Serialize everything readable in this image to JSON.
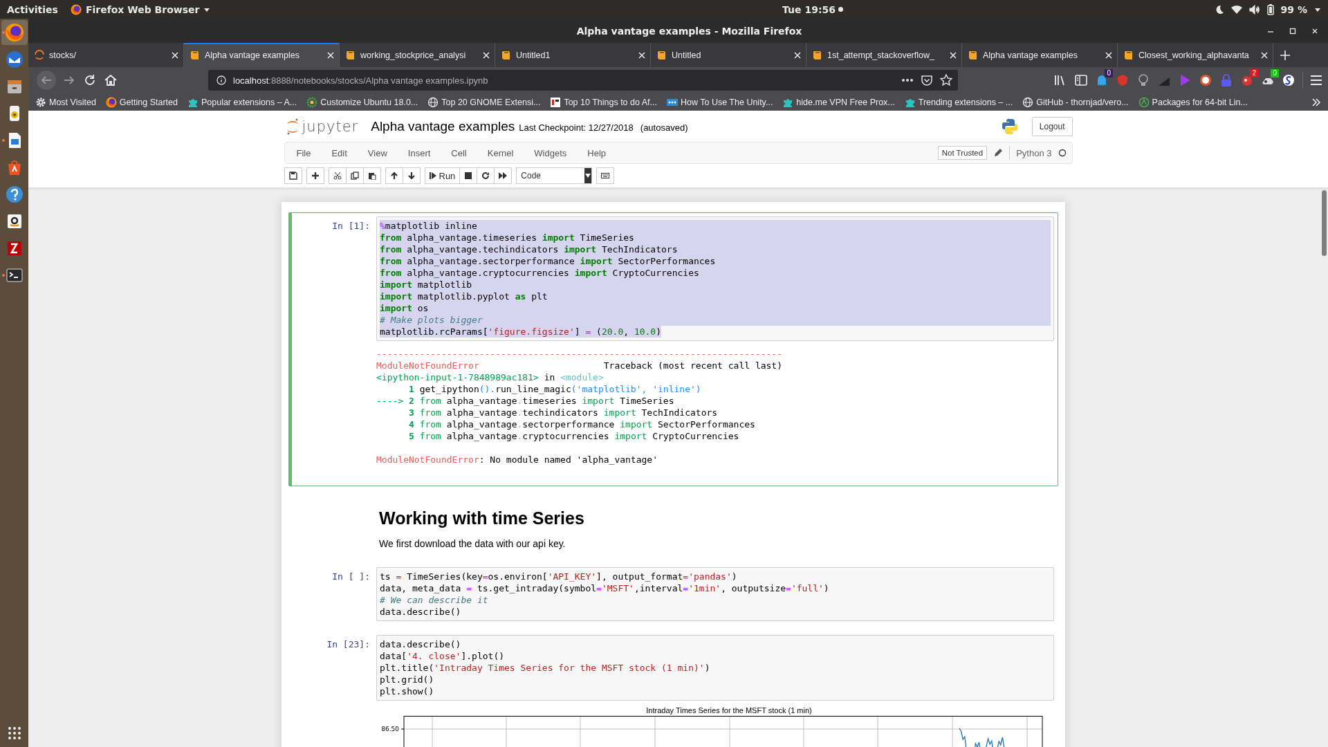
{
  "top_bar": {
    "activities": "Activities",
    "app_menu": "Firefox Web Browser",
    "clock": "Tue 19:56",
    "battery": "99 %"
  },
  "dock": [
    {
      "kind": "firefox",
      "running": true,
      "selected": true
    },
    {
      "kind": "mail",
      "running": false,
      "selected": false
    },
    {
      "kind": "files",
      "running": false,
      "selected": false
    },
    {
      "kind": "music",
      "running": false,
      "selected": false
    },
    {
      "kind": "writer",
      "running": true,
      "selected": false
    },
    {
      "kind": "software",
      "running": false,
      "selected": false
    },
    {
      "kind": "help",
      "running": false,
      "selected": false
    },
    {
      "kind": "amazon",
      "running": false,
      "selected": false
    },
    {
      "kind": "filezilla",
      "running": false,
      "selected": false
    },
    {
      "kind": "terminal",
      "running": true,
      "selected": false
    }
  ],
  "window": {
    "title": "Alpha vantage examples - Mozilla Firefox"
  },
  "tabs": [
    {
      "label": "stocks/",
      "kind": "jupyter",
      "selected": false
    },
    {
      "label": "Alpha vantage examples",
      "kind": "notebook",
      "selected": true
    },
    {
      "label": "working_stockprice_analysi",
      "kind": "notebook",
      "selected": false
    },
    {
      "label": "Untitled1",
      "kind": "notebook",
      "selected": false
    },
    {
      "label": "Untitled",
      "kind": "notebook",
      "selected": false
    },
    {
      "label": "1st_attempt_stackoverflow_",
      "kind": "notebook",
      "selected": false
    },
    {
      "label": "Alpha vantage examples",
      "kind": "notebook",
      "selected": false
    },
    {
      "label": "Closest_working_alphavanta",
      "kind": "notebook",
      "selected": false
    }
  ],
  "address_bar": {
    "host": "localhost",
    "path": ":8888/notebooks/stocks/Alpha vantage examples.ipynb"
  },
  "toolbar_badges": [
    {
      "text": "0",
      "color": "#3b1d5e"
    },
    {
      "text": "2",
      "color": "#e8141c"
    },
    {
      "text": "0",
      "color": "#16c60c"
    }
  ],
  "bookmarks": [
    {
      "label": "Most Visited",
      "kind": "gear"
    },
    {
      "label": "Getting Started",
      "kind": "firefox"
    },
    {
      "label": "Popular extensions – A...",
      "kind": "puzzle"
    },
    {
      "label": "Customize Ubuntu 18.0...",
      "kind": "cog"
    },
    {
      "label": "Top 20 GNOME Extensi...",
      "kind": "globe"
    },
    {
      "label": "Top 10 Things to do Af...",
      "kind": "square"
    },
    {
      "label": "How To Use The Unity...",
      "kind": "dots"
    },
    {
      "label": "hide.me VPN Free Prox...",
      "kind": "puzzle"
    },
    {
      "label": "Trending extensions – ...",
      "kind": "puzzle"
    },
    {
      "label": "GitHub - thornjad/vero...",
      "kind": "globe"
    },
    {
      "label": "Packages for 64-bit Lin...",
      "kind": "circle"
    }
  ],
  "notebook": {
    "logo": "jupyter",
    "title": "Alpha vantage examples",
    "checkpoint": "Last Checkpoint: 12/27/2018",
    "autosave": "(autosaved)",
    "logout": "Logout",
    "menu": [
      "File",
      "Edit",
      "View",
      "Insert",
      "Cell",
      "Kernel",
      "Widgets",
      "Help"
    ],
    "trust": "Not Trusted",
    "kernel": {
      "name": "Python 3",
      "busy": false
    },
    "run_label": "Run",
    "cell_type": "Code",
    "cells": [
      {
        "kind": "code",
        "prompt": "In [1]:",
        "selected": true,
        "lines": [
          {
            "selected": true,
            "tokens": [
              {
                "kind": "magic",
                "text": "%"
              },
              {
                "kind": "plain",
                "text": "matplotlib inline"
              }
            ]
          },
          {
            "selected": true,
            "tokens": [
              {
                "kind": "kw",
                "text": "from"
              },
              {
                "kind": "plain",
                "text": " alpha_vantage.timeseries "
              },
              {
                "kind": "kw",
                "text": "import"
              },
              {
                "kind": "plain",
                "text": " TimeSeries"
              }
            ]
          },
          {
            "selected": true,
            "tokens": [
              {
                "kind": "kw",
                "text": "from"
              },
              {
                "kind": "plain",
                "text": " alpha_vantage.techindicators "
              },
              {
                "kind": "kw",
                "text": "import"
              },
              {
                "kind": "plain",
                "text": " TechIndicators"
              }
            ]
          },
          {
            "selected": true,
            "tokens": [
              {
                "kind": "kw",
                "text": "from"
              },
              {
                "kind": "plain",
                "text": " alpha_vantage.sectorperformance "
              },
              {
                "kind": "kw",
                "text": "import"
              },
              {
                "kind": "plain",
                "text": " SectorPerformances"
              }
            ]
          },
          {
            "selected": true,
            "tokens": [
              {
                "kind": "kw",
                "text": "from"
              },
              {
                "kind": "plain",
                "text": " alpha_vantage.cryptocurrencies "
              },
              {
                "kind": "kw",
                "text": "import"
              },
              {
                "kind": "plain",
                "text": " CryptoCurrencies"
              }
            ]
          },
          {
            "selected": true,
            "tokens": [
              {
                "kind": "kw",
                "text": "import"
              },
              {
                "kind": "plain",
                "text": " matplotlib"
              }
            ]
          },
          {
            "selected": true,
            "tokens": [
              {
                "kind": "kw",
                "text": "import"
              },
              {
                "kind": "plain",
                "text": " matplotlib.pyplot "
              },
              {
                "kind": "kw",
                "text": "as"
              },
              {
                "kind": "plain",
                "text": " plt"
              }
            ]
          },
          {
            "selected": true,
            "tokens": [
              {
                "kind": "kw",
                "text": "import"
              },
              {
                "kind": "plain",
                "text": " os"
              }
            ]
          },
          {
            "selected": true,
            "tokens": [
              {
                "kind": "comment",
                "text": "# Make plots bigger"
              }
            ]
          },
          {
            "selected": true,
            "tokens": [
              {
                "kind": "plain",
                "text": "matplotlib.rcParams["
              },
              {
                "kind": "str",
                "text": "'figure.figsize'"
              },
              {
                "kind": "plain",
                "text": "] "
              },
              {
                "kind": "op",
                "text": "="
              },
              {
                "kind": "plain",
                "text": " ("
              },
              {
                "kind": "num",
                "text": "20.0"
              },
              {
                "kind": "plain",
                "text": ", "
              },
              {
                "kind": "num",
                "text": "10.0"
              },
              {
                "kind": "plain",
                "text": ")"
              }
            ]
          }
        ],
        "output": {
          "kind": "error",
          "traceback": [
            [
              {
                "kind": "err",
                "text": "---------------------------------------------------------------------------"
              }
            ],
            [
              {
                "kind": "err",
                "text": "ModuleNotFoundError"
              },
              {
                "kind": "plain",
                "text": "                       Traceback (most recent call last)"
              }
            ],
            [
              {
                "kind": "file",
                "text": "<ipython-input-1-7848989ac181>"
              },
              {
                "kind": "plain",
                "text": " in "
              },
              {
                "kind": "mod",
                "text": "<module>"
              }
            ],
            [
              {
                "kind": "lineno",
                "text": "      1 "
              },
              {
                "kind": "plain",
                "text": "get_ipython"
              },
              {
                "kind": "call",
                "text": "()."
              },
              {
                "kind": "plain",
                "text": "run_line_magic"
              },
              {
                "kind": "call",
                "text": "('matplotlib', 'inline')"
              }
            ],
            [
              {
                "kind": "arrow",
                "text": "----> "
              },
              {
                "kind": "lineno",
                "text": "2 "
              },
              {
                "kind": "tkw",
                "text": "from"
              },
              {
                "kind": "plain",
                "text": " alpha_vantage"
              },
              {
                "kind": "mod",
                "text": "."
              },
              {
                "kind": "plain",
                "text": "timeseries "
              },
              {
                "kind": "tkw",
                "text": "import"
              },
              {
                "kind": "plain",
                "text": " TimeSeries"
              }
            ],
            [
              {
                "kind": "lineno",
                "text": "      3 "
              },
              {
                "kind": "tkw",
                "text": "from"
              },
              {
                "kind": "plain",
                "text": " alpha_vantage"
              },
              {
                "kind": "mod",
                "text": "."
              },
              {
                "kind": "plain",
                "text": "techindicators "
              },
              {
                "kind": "tkw",
                "text": "import"
              },
              {
                "kind": "plain",
                "text": " TechIndicators"
              }
            ],
            [
              {
                "kind": "lineno",
                "text": "      4 "
              },
              {
                "kind": "tkw",
                "text": "from"
              },
              {
                "kind": "plain",
                "text": " alpha_vantage"
              },
              {
                "kind": "mod",
                "text": "."
              },
              {
                "kind": "plain",
                "text": "sectorperformance "
              },
              {
                "kind": "tkw",
                "text": "import"
              },
              {
                "kind": "plain",
                "text": " SectorPerformances"
              }
            ],
            [
              {
                "kind": "lineno",
                "text": "      5 "
              },
              {
                "kind": "tkw",
                "text": "from"
              },
              {
                "kind": "plain",
                "text": " alpha_vantage"
              },
              {
                "kind": "mod",
                "text": "."
              },
              {
                "kind": "plain",
                "text": "cryptocurrencies "
              },
              {
                "kind": "tkw",
                "text": "import"
              },
              {
                "kind": "plain",
                "text": " CryptoCurrencies"
              }
            ]
          ],
          "message": [
            {
              "kind": "err",
              "text": "ModuleNotFoundError"
            },
            {
              "kind": "plain",
              "text": ": No module named 'alpha_vantage'"
            }
          ]
        }
      },
      {
        "kind": "markdown",
        "selected": false,
        "heading": "Working with time Series",
        "text": "We first download the data with our api key."
      },
      {
        "kind": "code",
        "prompt": "In [ ]:",
        "selected": false,
        "lines": [
          {
            "selected": false,
            "tokens": [
              {
                "kind": "plain",
                "text": "ts "
              },
              {
                "kind": "op",
                "text": "="
              },
              {
                "kind": "plain",
                "text": " TimeSeries(key"
              },
              {
                "kind": "op",
                "text": "="
              },
              {
                "kind": "plain",
                "text": "os.environ["
              },
              {
                "kind": "str",
                "text": "'API_KEY'"
              },
              {
                "kind": "plain",
                "text": "], output_format"
              },
              {
                "kind": "op",
                "text": "="
              },
              {
                "kind": "str",
                "text": "'pandas'"
              },
              {
                "kind": "plain",
                "text": ")"
              }
            ]
          },
          {
            "selected": false,
            "tokens": [
              {
                "kind": "plain",
                "text": "data, meta_data "
              },
              {
                "kind": "op",
                "text": "="
              },
              {
                "kind": "plain",
                "text": " ts.get_intraday(symbol"
              },
              {
                "kind": "op",
                "text": "="
              },
              {
                "kind": "str",
                "text": "'MSFT'"
              },
              {
                "kind": "plain",
                "text": ",interval"
              },
              {
                "kind": "op",
                "text": "="
              },
              {
                "kind": "str",
                "text": "'1min'"
              },
              {
                "kind": "plain",
                "text": ", outputsize"
              },
              {
                "kind": "op",
                "text": "="
              },
              {
                "kind": "str",
                "text": "'full'"
              },
              {
                "kind": "plain",
                "text": ")"
              }
            ]
          },
          {
            "selected": false,
            "tokens": [
              {
                "kind": "comment",
                "text": "# We can describe it"
              }
            ]
          },
          {
            "selected": false,
            "tokens": [
              {
                "kind": "plain",
                "text": "data.describe()"
              }
            ]
          }
        ]
      },
      {
        "kind": "code",
        "prompt": "In [23]:",
        "selected": false,
        "lines": [
          {
            "selected": false,
            "tokens": [
              {
                "kind": "plain",
                "text": "data.describe()"
              }
            ]
          },
          {
            "selected": false,
            "tokens": [
              {
                "kind": "plain",
                "text": "data["
              },
              {
                "kind": "str",
                "text": "'4. close'"
              },
              {
                "kind": "plain",
                "text": "].plot()"
              }
            ]
          },
          {
            "selected": false,
            "tokens": [
              {
                "kind": "plain",
                "text": "plt.title("
              },
              {
                "kind": "str",
                "text": "'Intraday Times Series for the MSFT stock (1 min)'"
              },
              {
                "kind": "plain",
                "text": ")"
              }
            ]
          },
          {
            "selected": false,
            "tokens": [
              {
                "kind": "plain",
                "text": "plt.grid()"
              }
            ]
          },
          {
            "selected": false,
            "tokens": [
              {
                "kind": "plain",
                "text": "plt.show()"
              }
            ]
          }
        ],
        "output": {
          "kind": "plot",
          "title": "Intraday Times Series for the MSFT stock (1 min)",
          "y_tick": "86.50"
        }
      }
    ]
  }
}
